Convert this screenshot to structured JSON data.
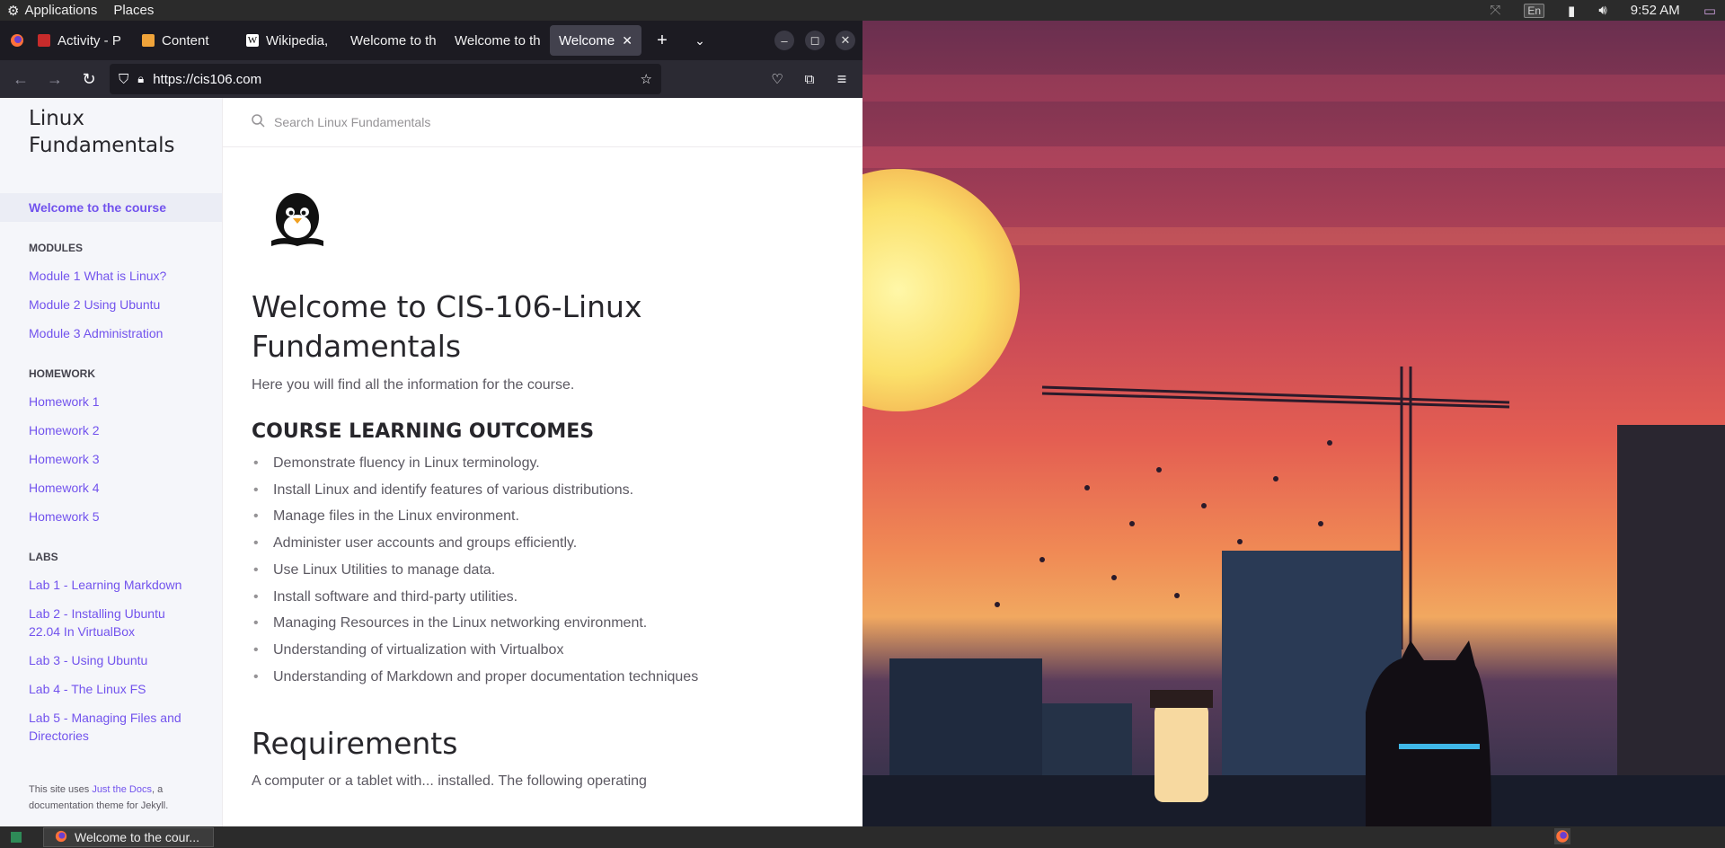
{
  "top_panel": {
    "applications_label": "Applications",
    "places_label": "Places",
    "keyboard_layout": "En",
    "clock": "9:52 AM"
  },
  "browser": {
    "tabs": [
      {
        "label": "Activity - P",
        "favicon_color": "#c72b2b"
      },
      {
        "label": "Content",
        "favicon_color": "#f0a43a"
      },
      {
        "label": "Wikipedia,",
        "favicon_color": "#ffffff"
      },
      {
        "label": "Welcome to th",
        "favicon_color": ""
      },
      {
        "label": "Welcome to th",
        "favicon_color": ""
      },
      {
        "label": "Welcome to",
        "favicon_color": "",
        "active": true
      }
    ],
    "url": "https://cis106.com"
  },
  "sidebar": {
    "site_title": "Linux Fundamentals",
    "home_label": "Welcome to the course",
    "modules_heading": "MODULES",
    "modules": [
      "Module 1 What is Linux?",
      "Module 2 Using Ubuntu",
      "Module 3 Administration"
    ],
    "homework_heading": "HOMEWORK",
    "homework": [
      "Homework 1",
      "Homework 2",
      "Homework 3",
      "Homework 4",
      "Homework 5"
    ],
    "labs_heading": "LABS",
    "labs": [
      "Lab 1 - Learning Markdown",
      "Lab 2 - Installing Ubuntu 22.04 In VirtualBox",
      "Lab 3 - Using Ubuntu",
      "Lab 4 - The Linux FS",
      "Lab 5 - Managing Files and Directories"
    ],
    "footer_prefix": "This site uses",
    "footer_link": "Just the Docs",
    "footer_suffix": ", a documentation theme for Jekyll."
  },
  "main": {
    "search_placeholder": "Search Linux Fundamentals",
    "title": "Welcome to CIS-106-Linux Fundamentals",
    "intro": "Here you will find all the information for the course.",
    "outcomes_heading": "COURSE LEARNING OUTCOMES",
    "outcomes": [
      "Demonstrate fluency in Linux terminology.",
      "Install Linux and identify features of various distributions.",
      "Manage files in the Linux environment.",
      "Administer user accounts and groups efficiently.",
      "Use Linux Utilities to manage data.",
      "Install software and third-party utilities.",
      "Managing Resources in the Linux networking environment.",
      "Understanding of virtualization with Virtualbox",
      "Understanding of Markdown and proper documentation techniques"
    ],
    "requirements_heading": "Requirements",
    "requirements_partial": "A computer or a tablet with... installed. The following operating"
  },
  "taskbar": {
    "window_label": "Welcome to the cour..."
  }
}
